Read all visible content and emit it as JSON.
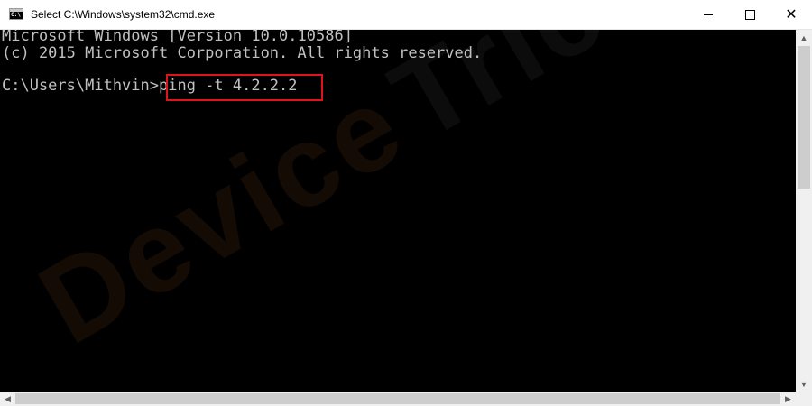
{
  "window": {
    "title": "Select C:\\Windows\\system32\\cmd.exe",
    "icon": "cmd-icon",
    "icon_text": "C:\\",
    "controls": {
      "minimize": "minimize-icon",
      "maximize": "maximize-icon",
      "close": "✕"
    }
  },
  "console": {
    "lines": [
      "Microsoft Windows [Version 10.0.10586]",
      "(c) 2015 Microsoft Corporation. All rights reserved.",
      "C:\\Users\\Mithvin>ping -t 4.2.2.2"
    ],
    "highlighted_command": "ping -t 4.2.2.2",
    "highlight_color": "#e0121a",
    "text_color": "#c0c0c0",
    "background": "#000000"
  },
  "watermark": {
    "part_a": "Device",
    "part_b": "Tricks"
  },
  "scrollbars": {
    "up": "▲",
    "down": "▼",
    "left": "◀",
    "right": "▶"
  }
}
